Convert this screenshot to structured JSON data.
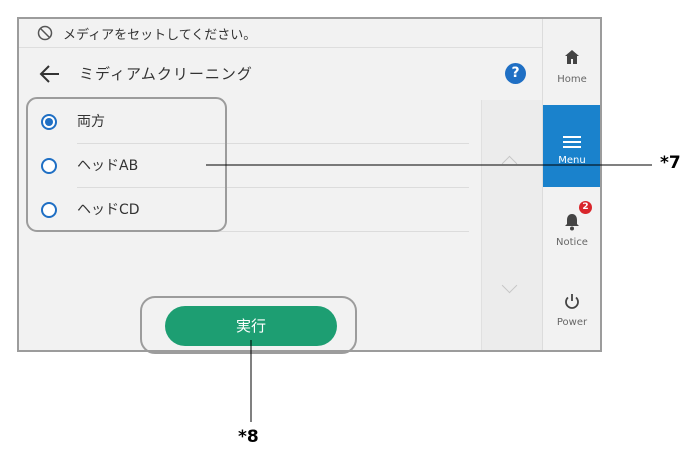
{
  "status": {
    "message": "メディアをセットしてください。"
  },
  "header": {
    "title": "ミディアムクリーニング",
    "help_label": "?"
  },
  "options": [
    {
      "label": "両方",
      "selected": true
    },
    {
      "label": "ヘッドAB",
      "selected": false
    },
    {
      "label": "ヘッドCD",
      "selected": false
    }
  ],
  "footer": {
    "execute_label": "実行"
  },
  "sidebar": {
    "home_label": "Home",
    "menu_label": "Menu",
    "notice_label": "Notice",
    "notice_count": "2",
    "power_label": "Power"
  },
  "callouts": {
    "options_label": "*7",
    "execute_label": "*8"
  },
  "colors": {
    "accent_blue": "#1f6fc4",
    "execute_green": "#1d9e72",
    "menu_active": "#1a82cc",
    "badge_red": "#d9262b"
  }
}
